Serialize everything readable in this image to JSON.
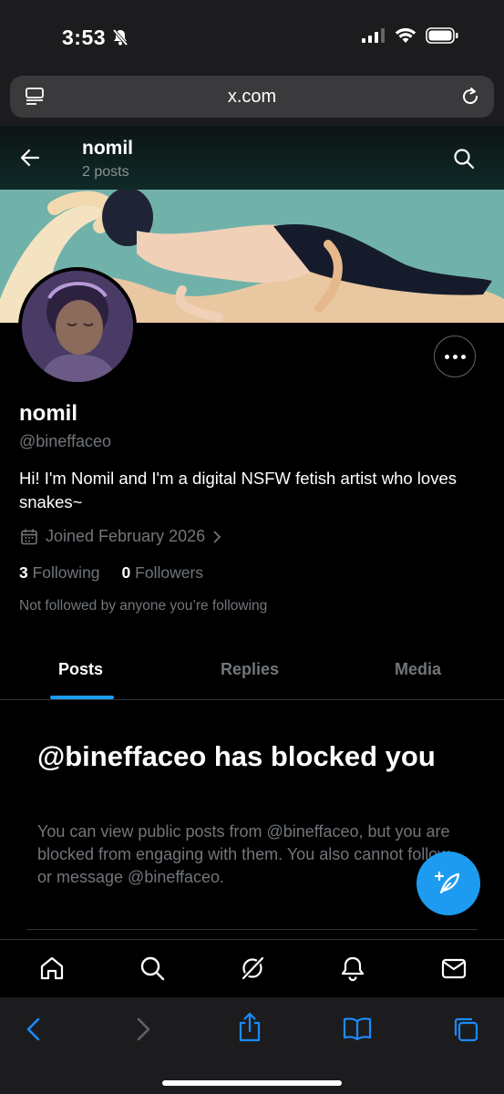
{
  "status": {
    "time": "3:53"
  },
  "browser": {
    "url": "x.com"
  },
  "header": {
    "name": "nomil",
    "posts": "2 posts"
  },
  "profile": {
    "display_name": "nomil",
    "handle": "@bineffaceo",
    "bio": "Hi! I'm Nomil and I'm a digital NSFW fetish artist who loves snakes~",
    "joined": "Joined February 2026",
    "following_count": "3",
    "following_label": "Following",
    "followers_count": "0",
    "followers_label": "Followers",
    "not_followed": "Not followed by anyone you’re following"
  },
  "tabs": [
    {
      "label": "Posts",
      "active": true
    },
    {
      "label": "Replies",
      "active": false
    },
    {
      "label": "Media",
      "active": false
    }
  ],
  "blocked": {
    "title": "@bineffaceo has blocked you",
    "text": "You can view public posts from @bineffaceo, but you are blocked from engaging with them. You also cannot follow or message @bineffaceo."
  },
  "nav": [
    "home-icon",
    "search-icon",
    "grok-icon",
    "notifications-icon",
    "messages-icon"
  ],
  "safari": [
    "back-icon",
    "forward-icon",
    "share-icon",
    "bookmarks-icon",
    "tabs-icon"
  ],
  "colors": {
    "accent": "#1d9bf0",
    "muted": "#71767b",
    "banner": "#6cada6"
  }
}
